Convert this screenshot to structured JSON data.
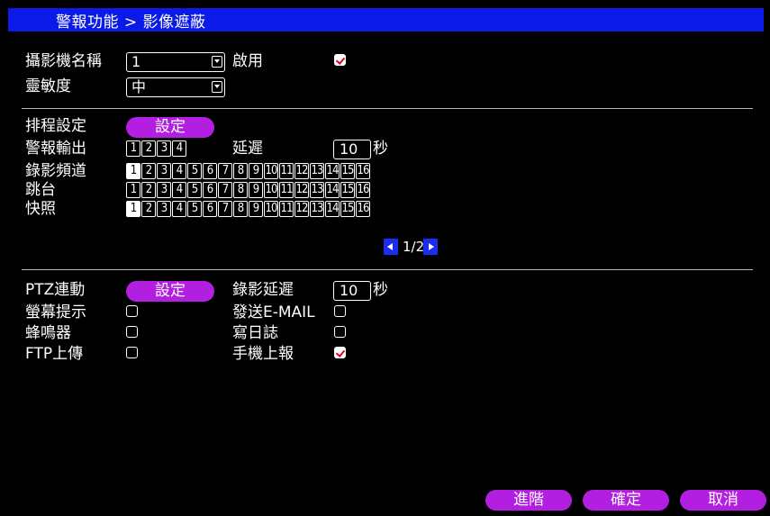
{
  "title": "警報功能 > 影像遮蔽",
  "camera": {
    "label": "攝影機名稱",
    "value": "1",
    "enable_label": "啟用",
    "enable_checked": true
  },
  "sensitivity": {
    "label": "靈敏度",
    "value": "中"
  },
  "schedule": {
    "label": "排程設定",
    "button": "設定"
  },
  "alarm_output": {
    "label": "警報輸出",
    "channels": [
      "1",
      "2",
      "3",
      "4"
    ],
    "delay_label": "延遲",
    "delay_value": "10",
    "delay_unit": "秒"
  },
  "record_channel": {
    "label": "錄影頻道",
    "channels": [
      "1",
      "2",
      "3",
      "4",
      "5",
      "6",
      "7",
      "8",
      "9",
      "10",
      "11",
      "12",
      "13",
      "14",
      "15",
      "16"
    ],
    "selected": [
      "1"
    ]
  },
  "tour": {
    "label": "跳台",
    "channels": [
      "1",
      "2",
      "3",
      "4",
      "5",
      "6",
      "7",
      "8",
      "9",
      "10",
      "11",
      "12",
      "13",
      "14",
      "15",
      "16"
    ],
    "selected": []
  },
  "snapshot": {
    "label": "快照",
    "channels": [
      "1",
      "2",
      "3",
      "4",
      "5",
      "6",
      "7",
      "8",
      "9",
      "10",
      "11",
      "12",
      "13",
      "14",
      "15",
      "16"
    ],
    "selected": [
      "1"
    ]
  },
  "pager": {
    "text": "1/2"
  },
  "ptz": {
    "label": "PTZ連動",
    "button": "設定"
  },
  "record_delay": {
    "label": "錄影延遲",
    "value": "10",
    "unit": "秒"
  },
  "options": {
    "screen_prompt": {
      "label": "螢幕提示",
      "checked": false
    },
    "send_email": {
      "label": "發送E-MAIL",
      "checked": false
    },
    "buzzer": {
      "label": "蜂鳴器",
      "checked": false
    },
    "write_log": {
      "label": "寫日誌",
      "checked": false
    },
    "ftp_upload": {
      "label": "FTP上傳",
      "checked": false
    },
    "mobile_report": {
      "label": "手機上報",
      "checked": true
    }
  },
  "footer": {
    "advanced": "進階",
    "ok": "確定",
    "cancel": "取消"
  },
  "colors": {
    "title_bar": "#0b1ae6",
    "button": "#b31fe0",
    "nav": "#1a2df0",
    "check": "#d80818"
  }
}
